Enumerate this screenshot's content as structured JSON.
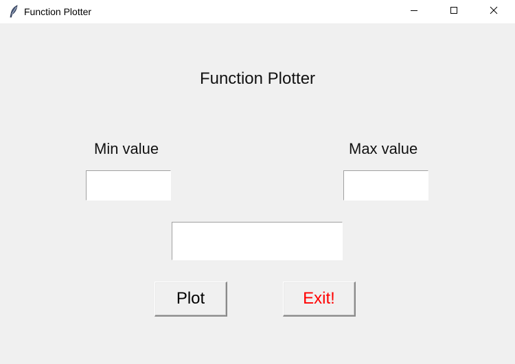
{
  "window": {
    "title": "Function Plotter",
    "icon": "feather-icon",
    "controls": {
      "minimize_icon": "minimize-icon",
      "maximize_icon": "maximize-icon",
      "close_icon": "close-icon"
    }
  },
  "main": {
    "heading": "Function Plotter",
    "min_label": "Min value",
    "max_label": "Max value",
    "min_value": "",
    "max_value": "",
    "function_value": ""
  },
  "buttons": {
    "plot_label": "Plot",
    "exit_label": "Exit!",
    "exit_color": "#ff0000"
  }
}
